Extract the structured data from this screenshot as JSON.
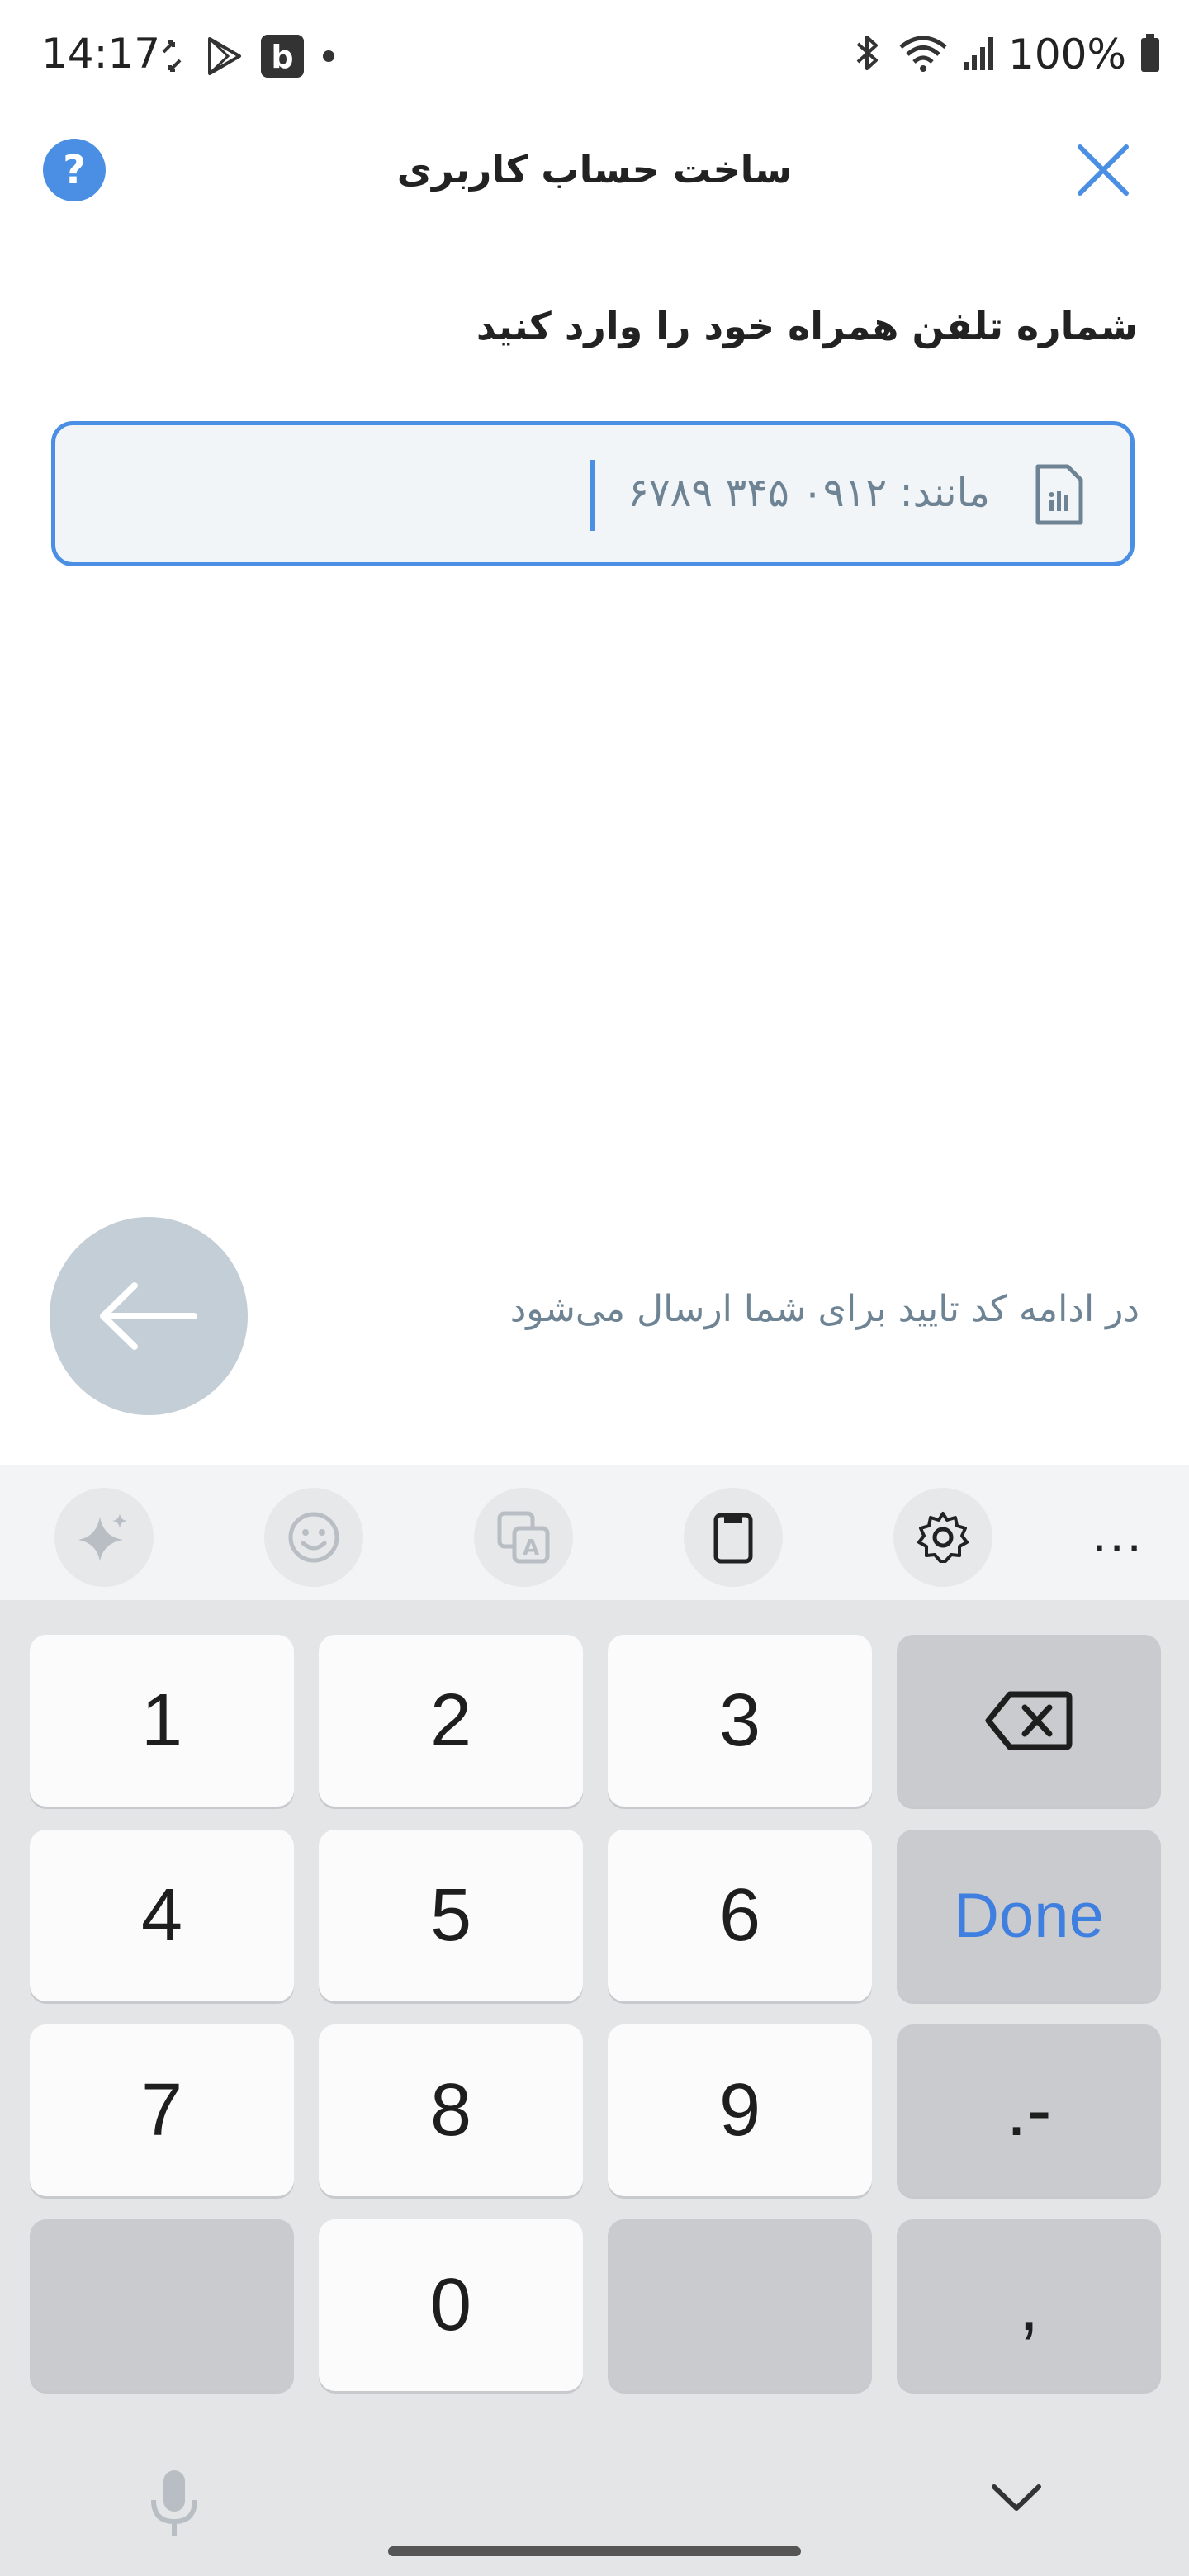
{
  "status_bar": {
    "time": "14:17",
    "battery": "100%",
    "left_icons": [
      "sync-icon",
      "play-store-icon",
      "b-app-icon",
      "dot-icon"
    ],
    "right_icons": [
      "bluetooth-icon",
      "wifi-icon",
      "signal-icon",
      "battery-icon"
    ]
  },
  "header": {
    "title": "ساخت حساب کاربری",
    "help_label": "?"
  },
  "form": {
    "prompt": "شماره تلفن همراه خود را وارد کنید",
    "phone_placeholder": "مانند: ۰۹۱۲ ۳۴۵ ۶۷۸۹",
    "phone_value": ""
  },
  "footer": {
    "hint": "در ادامه کد تایید برای شما ارسال می‌شود"
  },
  "keyboard": {
    "toolbar": [
      "sparkle-icon",
      "emoji-icon",
      "translate-icon",
      "clipboard-icon",
      "settings-icon"
    ],
    "more": "...",
    "keys": [
      "1",
      "2",
      "3",
      "4",
      "5",
      "6",
      "7",
      "8",
      "9",
      "0"
    ],
    "done": "Done",
    "dot_dash": ".-",
    "comma": ","
  },
  "colors": {
    "accent": "#4a8fe3",
    "hint_text": "#6e8494",
    "next_button": "#c3ced6"
  }
}
